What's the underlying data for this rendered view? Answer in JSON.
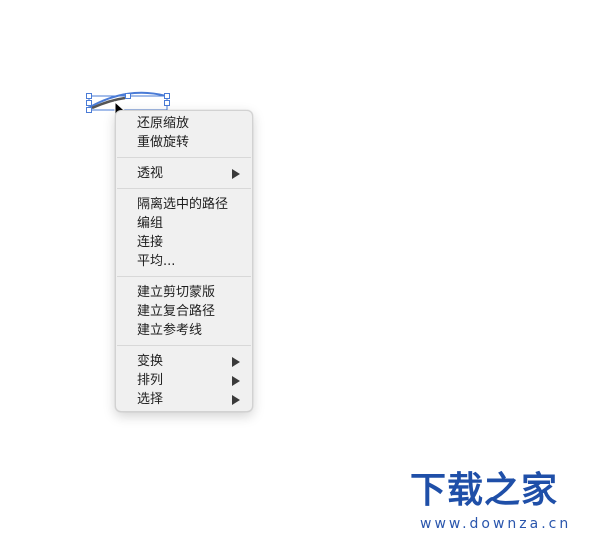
{
  "context_menu": {
    "groups": [
      {
        "items": [
          {
            "label": "还原缩放"
          },
          {
            "label": "重做旋转"
          }
        ]
      },
      {
        "items": [
          {
            "label": "透视",
            "submenu": true
          }
        ]
      },
      {
        "items": [
          {
            "label": "隔离选中的路径"
          },
          {
            "label": "编组"
          },
          {
            "label": "连接"
          },
          {
            "label": "平均..."
          }
        ]
      },
      {
        "items": [
          {
            "label": "建立剪切蒙版"
          },
          {
            "label": "建立复合路径"
          },
          {
            "label": "建立参考线"
          }
        ]
      },
      {
        "items": [
          {
            "label": "变换",
            "submenu": true
          },
          {
            "label": "排列",
            "submenu": true
          },
          {
            "label": "选择",
            "submenu": true
          }
        ]
      }
    ]
  },
  "watermark": {
    "brand": "下载之家",
    "url": "www.downza.cn",
    "color": "#1f4fa8"
  },
  "selection_color": "#4a7bd6"
}
